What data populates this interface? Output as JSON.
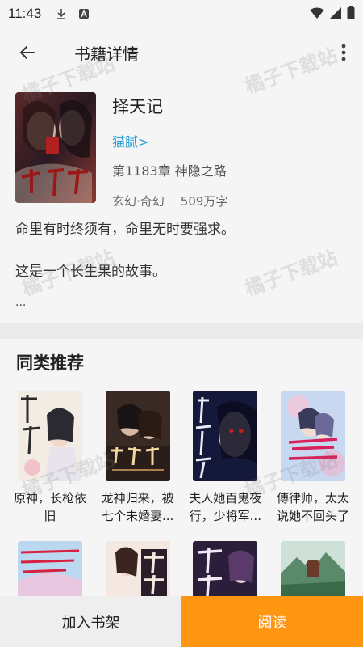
{
  "status_bar": {
    "time": "11:43"
  },
  "header": {
    "title": "书籍详情"
  },
  "book": {
    "title": "择天记",
    "author": "猫腻>",
    "latest_chapter": "第1183章 神隐之路",
    "genre": "玄幻·奇幻",
    "word_count": "509万字",
    "intro_line1": "命里有时终须有，命里无时要强求。",
    "intro_line2": "这是一个长生果的故事。",
    "intro_more": "..."
  },
  "recommend": {
    "title": "同类推荐",
    "row1": [
      {
        "name": "原神，长枪依旧"
      },
      {
        "name": "龙神归来，被七个未婚妻..."
      },
      {
        "name": "夫人她百鬼夜行，少将军..."
      },
      {
        "name": "傅律师，太太说她不回头了"
      }
    ]
  },
  "actions": {
    "add_to_shelf": "加入书架",
    "read": "阅读"
  },
  "watermark": "橘子下载站",
  "colors": {
    "accent": "#ff9612",
    "author_link": "#2a9fd8"
  }
}
